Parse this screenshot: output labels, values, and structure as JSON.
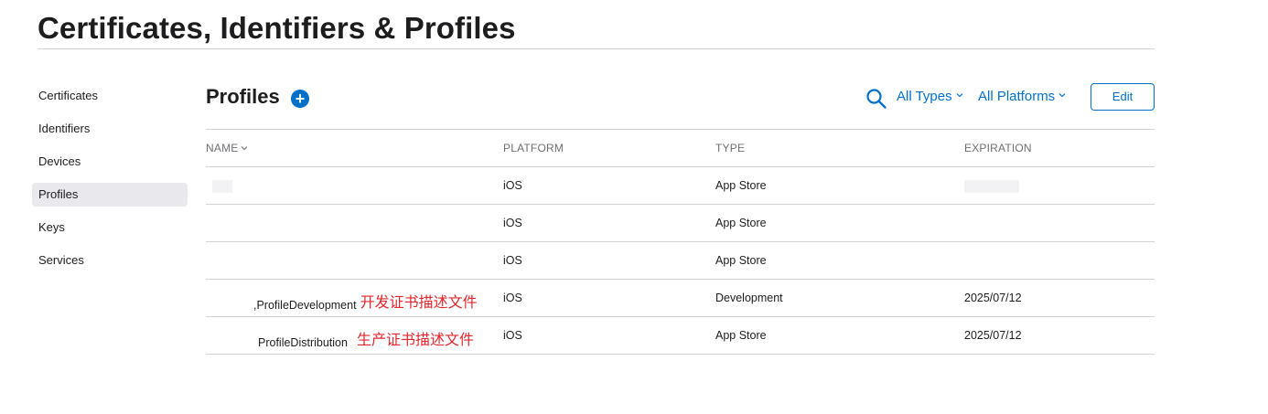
{
  "page": {
    "title": "Certificates, Identifiers & Profiles"
  },
  "sidebar": {
    "items": [
      {
        "label": "Certificates",
        "active": false
      },
      {
        "label": "Identifiers",
        "active": false
      },
      {
        "label": "Devices",
        "active": false
      },
      {
        "label": "Profiles",
        "active": true
      },
      {
        "label": "Keys",
        "active": false
      },
      {
        "label": "Services",
        "active": false
      }
    ]
  },
  "section": {
    "title": "Profiles",
    "add_label": "+"
  },
  "toolbar": {
    "filter_type": "All Types",
    "filter_platform": "All Platforms",
    "edit_label": "Edit"
  },
  "table": {
    "headers": {
      "name": "NAME",
      "platform": "PLATFORM",
      "type": "TYPE",
      "expiration": "EXPIRATION"
    },
    "rows": [
      {
        "name": "",
        "annotation": "",
        "platform": "iOS",
        "type": "App Store",
        "expiration": ""
      },
      {
        "name": "",
        "annotation": "",
        "platform": "iOS",
        "type": "App Store",
        "expiration": ""
      },
      {
        "name": "",
        "annotation": "",
        "platform": "iOS",
        "type": "App Store",
        "expiration": ""
      },
      {
        "name": ",ProfileDevelopment",
        "annotation": "开发证书描述文件",
        "platform": "iOS",
        "type": "Development",
        "expiration": "2025/07/12"
      },
      {
        "name": "ProfileDistribution",
        "annotation": "生产证书描述文件",
        "platform": "iOS",
        "type": "App Store",
        "expiration": "2025/07/12"
      }
    ]
  },
  "colors": {
    "accent": "#0070c9",
    "annotation": "#e3262b",
    "expired": "#e3262b",
    "divider": "#d2d2d7"
  },
  "icons": {
    "search": "search-icon",
    "add": "plus-circle-icon",
    "chevron": "chevron-down-icon"
  }
}
